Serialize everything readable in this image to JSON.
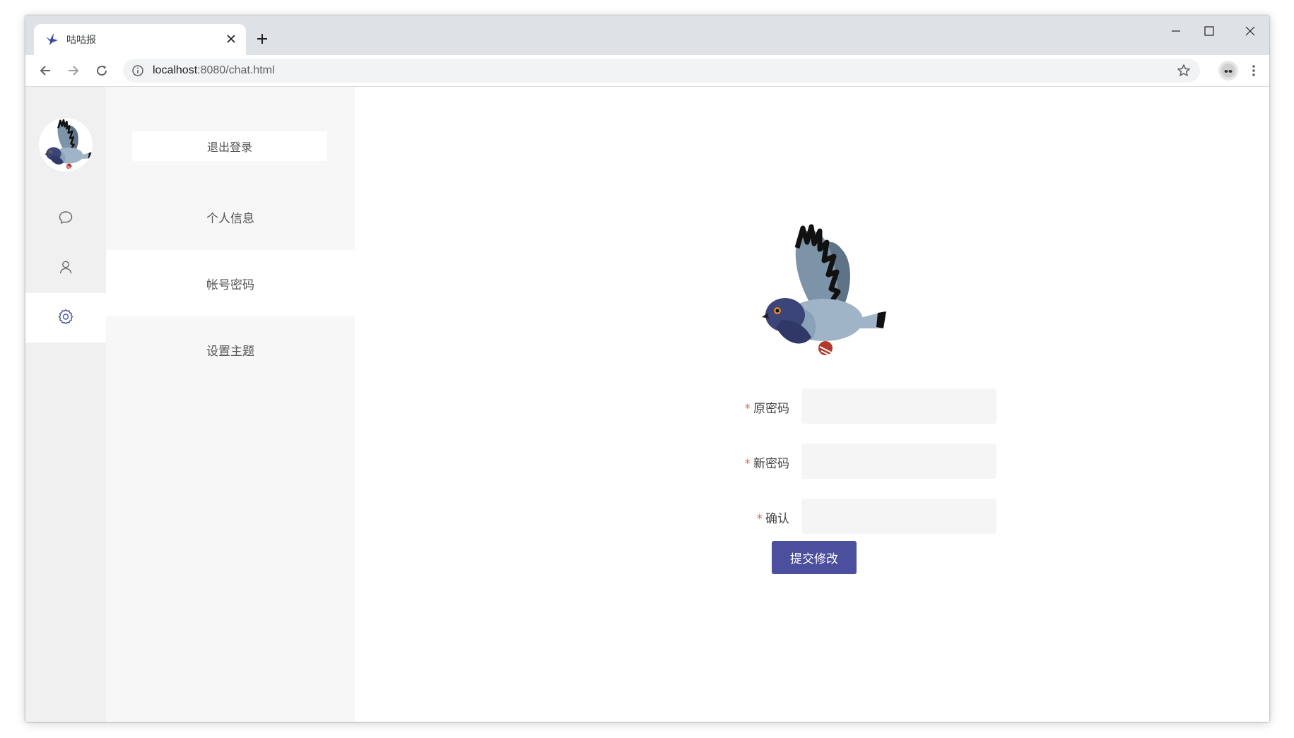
{
  "browser": {
    "tab_title": "咕咕报",
    "url_host": "localhost",
    "url_rest": ":8080/chat.html"
  },
  "sidebar": {
    "nav_icons": [
      "chat-icon",
      "user-icon",
      "settings-icon"
    ],
    "active_icon": "settings-icon"
  },
  "menu": {
    "logout_label": "退出登录",
    "items": [
      {
        "label": "个人信息"
      },
      {
        "label": "帐号密码"
      },
      {
        "label": "设置主题"
      }
    ],
    "active_index": 1
  },
  "form": {
    "required_mark": "*",
    "old_password_label": "原密码",
    "new_password_label": "新密码",
    "confirm_label": "确认",
    "old_password_value": "",
    "new_password_value": "",
    "confirm_value": "",
    "submit_label": "提交修改"
  },
  "colors": {
    "accent": "#4b4f9d",
    "required": "#e06464",
    "sidebar_bg": "#f0f0f0",
    "menu_bg": "#f7f7f7"
  }
}
